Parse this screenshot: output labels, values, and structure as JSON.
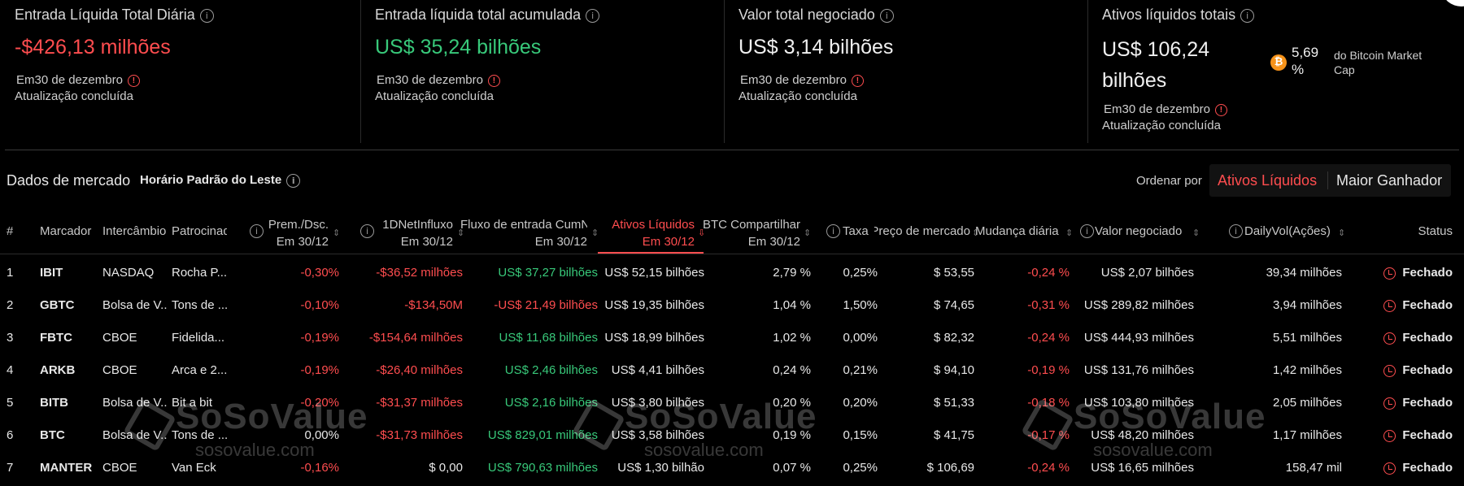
{
  "stats": [
    {
      "title": "Entrada Líquida Total Diária",
      "value": "-$426,13 milhões",
      "tone": "neg",
      "date": "Em30 de dezembro",
      "status": "Atualização concluída"
    },
    {
      "title": "Entrada líquida total acumulada",
      "value": "US$ 35,24 bilhões",
      "tone": "pos",
      "date": "Em30 de dezembro",
      "status": "Atualização concluída"
    },
    {
      "title": "Valor total negociado",
      "value": "US$ 3,14 bilhões",
      "tone": "",
      "date": "Em30 de dezembro",
      "status": "Atualização concluída"
    },
    {
      "title": "Ativos líquidos totais",
      "value_line1": "US$ 106,24",
      "value_line2": "bilhões",
      "pct_line1": "5,69",
      "pct_line2": "%",
      "pct_note": "do Bitcoin Market Cap",
      "date": "Em30 de dezembro",
      "status": "Atualização concluída"
    }
  ],
  "market": {
    "title": "Dados de mercado",
    "timezone": "Horário Padrão do Leste",
    "sort_label": "Ordenar por",
    "sort_options": [
      {
        "label": "Ativos Líquidos",
        "active": true
      },
      {
        "label": "Maior Ganhador",
        "active": false
      }
    ]
  },
  "table": {
    "headers": {
      "idx": "#",
      "ticker": "Marcador",
      "exchange": "Intercâmbio",
      "sponsor": "Patrocinador",
      "premium_1": "Prem./Dsc.",
      "premium_2": "Em 30/12",
      "daily_1": "1DNetInfluxo",
      "daily_2": "Em 30/12",
      "cum_1": "Fluxo de entrada CumNet",
      "cum_2": "Em 30/12",
      "assets_1": "Ativos Líquidos",
      "assets_2": "Em 30/12",
      "share_1": "BTC Compartilhar",
      "share_2": "Em 30/12",
      "fee": "Taxa",
      "price": "Preço de mercado",
      "change": "Mudança diária",
      "traded": "Valor negociado",
      "vol": "DailyVol(Ações)",
      "status": "Status"
    },
    "rows": [
      {
        "idx": "1",
        "ticker": "IBIT",
        "exchange": "NASDAQ",
        "sponsor": "Rocha P...",
        "premium": "-0,30%",
        "daily": "-$36,52 milhões",
        "cum": "US$ 37,27 bilhões",
        "assets": "US$ 52,15 bilhões",
        "share": "2,79 %",
        "fee": "0,25%",
        "price": "$ 53,55",
        "change": "-0,24 %",
        "traded": "US$ 2,07 bilhões",
        "vol": "39,34 milhões",
        "status": "Fechado"
      },
      {
        "idx": "2",
        "ticker": "GBTC",
        "exchange": "Bolsa de V...",
        "sponsor": "Tons de ...",
        "premium": "-0,10%",
        "daily": "-$134,50M",
        "cum": "-US$ 21,49 bilhões",
        "assets": "US$ 19,35 bilhões",
        "share": "1,04 %",
        "fee": "1,50%",
        "price": "$ 74,65",
        "change": "-0,31 %",
        "traded": "US$ 289,82 milhões",
        "vol": "3,94 milhões",
        "status": "Fechado"
      },
      {
        "idx": "3",
        "ticker": "FBTC",
        "exchange": "CBOE",
        "sponsor": "Fidelida...",
        "premium": "-0,19%",
        "daily": "-$154,64 milhões",
        "cum": "US$ 11,68 bilhões",
        "assets": "US$ 18,99 bilhões",
        "share": "1,02 %",
        "fee": "0,00%",
        "price": "$ 82,32",
        "change": "-0,24 %",
        "traded": "US$ 444,93 milhões",
        "vol": "5,51 milhões",
        "status": "Fechado"
      },
      {
        "idx": "4",
        "ticker": "ARKB",
        "exchange": "CBOE",
        "sponsor": "Arca e 2...",
        "premium": "-0,19%",
        "daily": "-$26,40 milhões",
        "cum": "US$ 2,46 bilhões",
        "assets": "US$ 4,41 bilhões",
        "share": "0,24 %",
        "fee": "0,21%",
        "price": "$ 94,10",
        "change": "-0,19 %",
        "traded": "US$ 131,76 milhões",
        "vol": "1,42 milhões",
        "status": "Fechado"
      },
      {
        "idx": "5",
        "ticker": "BITB",
        "exchange": "Bolsa de V...",
        "sponsor": "Bit a bit",
        "premium": "-0,20%",
        "daily": "-$31,37 milhões",
        "cum": "US$ 2,16 bilhões",
        "assets": "US$ 3,80 bilhões",
        "share": "0,20 %",
        "fee": "0,20%",
        "price": "$ 51,33",
        "change": "-0,18 %",
        "traded": "US$ 103,80 milhões",
        "vol": "2,05 milhões",
        "status": "Fechado"
      },
      {
        "idx": "6",
        "ticker": "BTC",
        "exchange": "Bolsa de V...",
        "sponsor": "Tons de ...",
        "premium": "0,00%",
        "daily": "-$31,73 milhões",
        "cum": "US$ 829,01 milhões",
        "assets": "US$ 3,58 bilhões",
        "share": "0,19 %",
        "fee": "0,15%",
        "price": "$ 41,75",
        "change": "-0,17 %",
        "traded": "US$ 48,20 milhões",
        "vol": "1,17 milhões",
        "status": "Fechado"
      },
      {
        "idx": "7",
        "ticker": "MANTER",
        "exchange": "CBOE",
        "sponsor": "Van Eck",
        "premium": "-0,16%",
        "daily": "$ 0,00",
        "cum": "US$ 790,63 milhões",
        "assets": "US$ 1,30 bilhão",
        "share": "0,07 %",
        "fee": "0,25%",
        "price": "$ 106,69",
        "change": "-0,24 %",
        "traded": "US$ 16,65 milhões",
        "vol": "158,47 mil",
        "status": "Fechado"
      }
    ]
  },
  "watermark": {
    "brand": "SoSoValue",
    "site": "sosovalue.com"
  },
  "colors": {
    "negative": "#ff4d4f",
    "positive": "#38c97a",
    "accent": "#ff4d4f"
  }
}
